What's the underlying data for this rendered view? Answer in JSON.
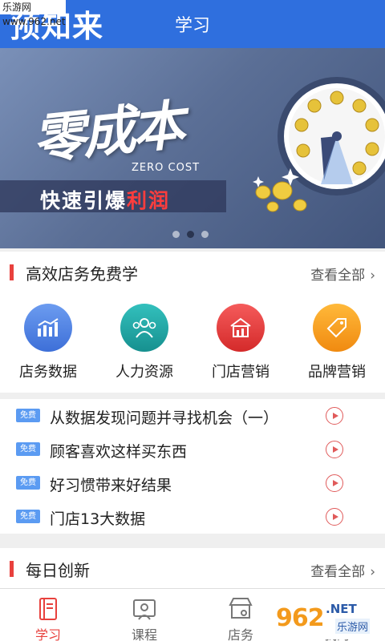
{
  "header": {
    "brand": "预知来",
    "title": "学习",
    "corner_watermark": "乐游网 www.962.net"
  },
  "banner": {
    "title": "零成本",
    "subtitle": "ZERO COST",
    "slogan_main": "快速引爆",
    "slogan_highlight": "利润",
    "slide_count": 3,
    "active_slide": 2
  },
  "section_store": {
    "title": "高效店务免费学",
    "more_label": "查看全部",
    "more_icon": "chevron-right-icon"
  },
  "categories": [
    {
      "label": "店务数据",
      "icon": "chart-icon",
      "color": "#4a7fe0"
    },
    {
      "label": "人力资源",
      "icon": "people-icon",
      "color": "#1fa5a5"
    },
    {
      "label": "门店营销",
      "icon": "store-icon",
      "color": "#e33c3c"
    },
    {
      "label": "品牌营销",
      "icon": "tag-icon",
      "color": "#f39a1c"
    }
  ],
  "courses": [
    {
      "badge": "免费",
      "title": "从数据发现问题并寻找机会（一）"
    },
    {
      "badge": "免费",
      "title": "顾客喜欢这样买东西"
    },
    {
      "badge": "免费",
      "title": "好习惯带来好结果"
    },
    {
      "badge": "免费",
      "title": "门店13大数据"
    }
  ],
  "section_daily": {
    "title": "每日创新",
    "more_label": "查看全部"
  },
  "tabbar": {
    "tabs": [
      {
        "label": "学习",
        "icon": "book-icon",
        "active": true
      },
      {
        "label": "课程",
        "icon": "course-icon",
        "active": false
      },
      {
        "label": "店务",
        "icon": "shop-icon",
        "active": false
      },
      {
        "label": "我的",
        "icon": "profile-icon",
        "active": false
      }
    ]
  },
  "watermark": {
    "logo_digits": "962",
    "logo_suffix": ".NET",
    "site_name": "乐游网"
  },
  "colors": {
    "header_blue": "#2f6fde",
    "accent_red": "#e8413d",
    "badge_blue": "#5b9bf2"
  }
}
